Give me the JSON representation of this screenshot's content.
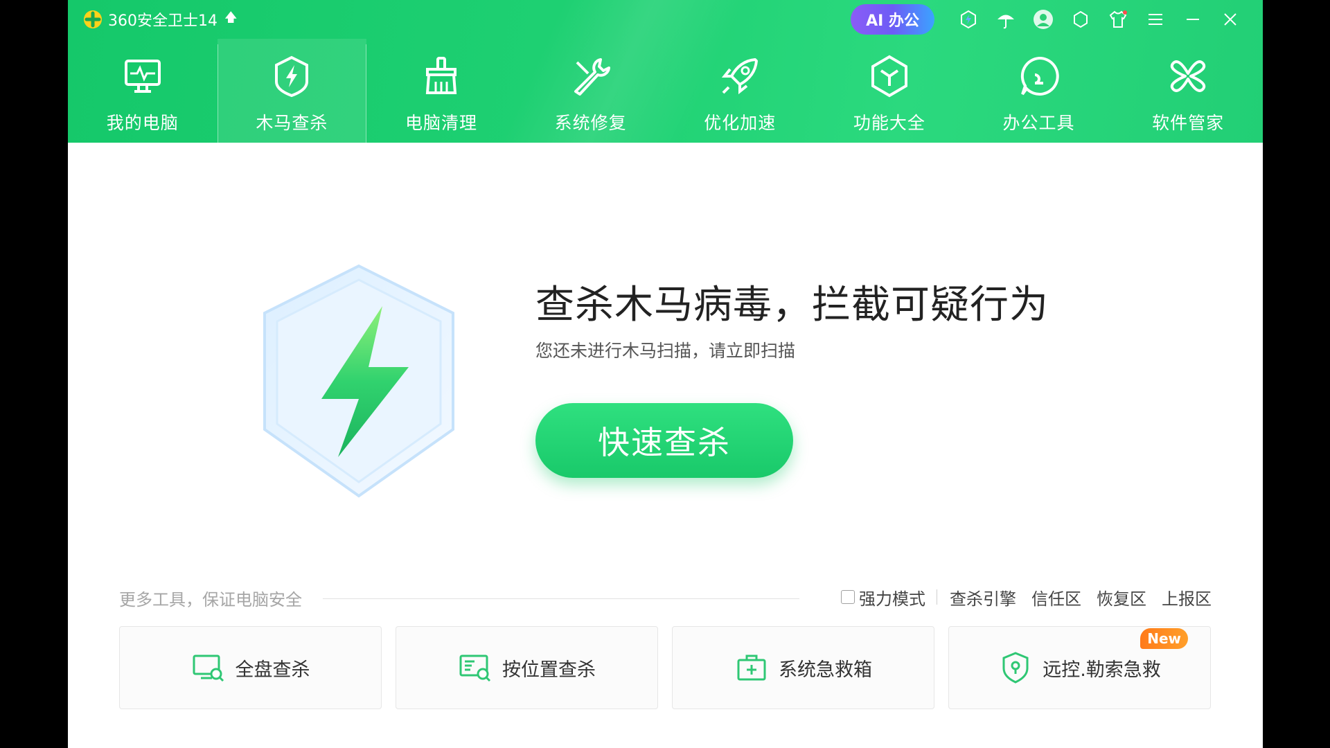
{
  "app": {
    "title": "360安全卫士14",
    "ai_button": "AI 办公"
  },
  "nav": [
    {
      "id": "my-pc",
      "label": "我的电脑",
      "icon": "monitor-pulse-icon",
      "active": false
    },
    {
      "id": "trojan-scan",
      "label": "木马查杀",
      "icon": "shield-bolt-icon",
      "active": true
    },
    {
      "id": "cleanup",
      "label": "电脑清理",
      "icon": "broom-icon",
      "active": false
    },
    {
      "id": "repair",
      "label": "系统修复",
      "icon": "wrench-icon",
      "active": false
    },
    {
      "id": "speedup",
      "label": "优化加速",
      "icon": "rocket-icon",
      "active": false
    },
    {
      "id": "features",
      "label": "功能大全",
      "icon": "hexagon-box-icon",
      "active": false
    },
    {
      "id": "office-tools",
      "label": "办公工具",
      "icon": "chat-bubble-icon",
      "active": false
    },
    {
      "id": "software",
      "label": "软件管家",
      "icon": "clover-icon",
      "active": false
    }
  ],
  "hero": {
    "title": "查杀木马病毒，拦截可疑行为",
    "subtitle": "您还未进行木马扫描，请立即扫描",
    "scan_button": "快速查杀"
  },
  "tools": {
    "more_label": "更多工具，保证电脑安全",
    "strong_mode": "强力模式",
    "strong_mode_checked": false,
    "links": [
      "查杀引擎",
      "信任区",
      "恢复区",
      "上报区"
    ],
    "cards": [
      {
        "label": "全盘查杀",
        "icon": "monitor-search-icon"
      },
      {
        "label": "按位置查杀",
        "icon": "location-search-icon"
      },
      {
        "label": "系统急救箱",
        "icon": "first-aid-kit-icon"
      },
      {
        "label": "远控.勒索急救",
        "icon": "shield-lock-icon",
        "badge": "New"
      }
    ]
  },
  "colors": {
    "header_green": "#1fd173",
    "button_green": "#19c96a",
    "badge_orange": "#ff8a1f"
  }
}
